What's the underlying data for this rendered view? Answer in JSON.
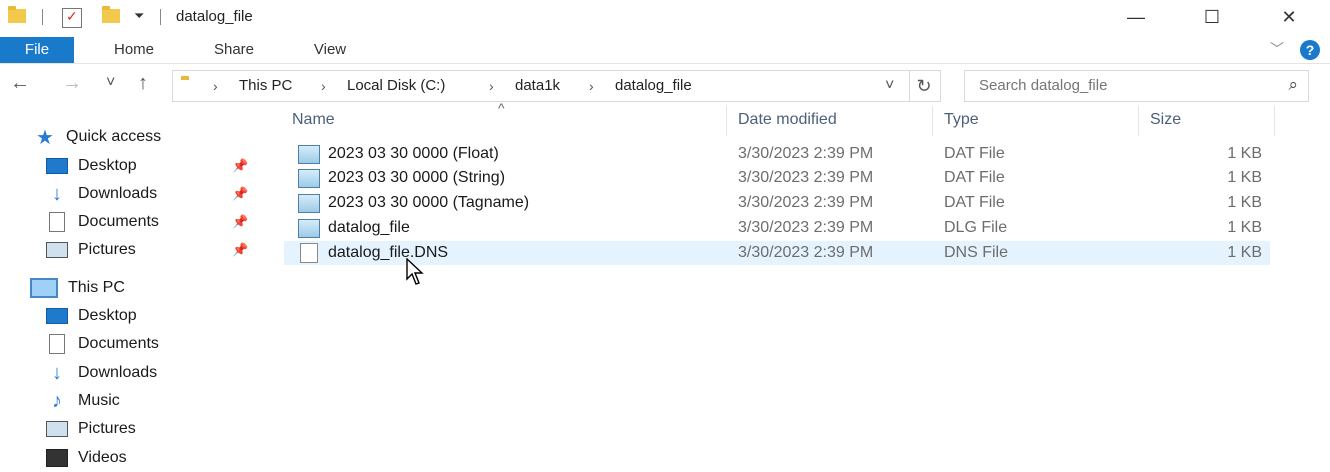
{
  "window": {
    "title": "datalog_file",
    "controls": {
      "minimize": "—",
      "maximize": "☐",
      "close": "✕"
    }
  },
  "ribbon": {
    "tabs": [
      "File",
      "Home",
      "Share",
      "View"
    ],
    "help": "?",
    "collapse_chevron": "﹀"
  },
  "navigation": {
    "back": "←",
    "forward": "→",
    "recent": "˅",
    "up": "↑",
    "breadcrumbs": [
      "This PC",
      "Local Disk (C:)",
      "data1k",
      "datalog_file"
    ],
    "crumb_sep": "›",
    "dropdown": "˅",
    "refresh": "↻",
    "search_placeholder": "Search datalog_file",
    "search_icon": "⌕"
  },
  "sidebar": {
    "quick_access": {
      "label": "Quick access",
      "icon": "star-icon",
      "items": [
        {
          "label": "Desktop",
          "icon": "desktop-icon",
          "pinned": true
        },
        {
          "label": "Downloads",
          "icon": "downloads-icon",
          "pinned": true
        },
        {
          "label": "Documents",
          "icon": "documents-icon",
          "pinned": true
        },
        {
          "label": "Pictures",
          "icon": "pictures-icon",
          "pinned": true
        }
      ]
    },
    "this_pc": {
      "label": "This PC",
      "icon": "computer-icon",
      "items": [
        {
          "label": "Desktop",
          "icon": "desktop-icon"
        },
        {
          "label": "Documents",
          "icon": "documents-icon"
        },
        {
          "label": "Downloads",
          "icon": "downloads-icon"
        },
        {
          "label": "Music",
          "icon": "music-icon"
        },
        {
          "label": "Pictures",
          "icon": "pictures-icon"
        },
        {
          "label": "Videos",
          "icon": "videos-icon"
        }
      ]
    },
    "pin_glyph": "📌"
  },
  "file_list": {
    "sort_caret": "^",
    "columns": [
      "Name",
      "Date modified",
      "Type",
      "Size"
    ],
    "rows": [
      {
        "name": "2023 03 30 0000 (Float)",
        "date": "3/30/2023 2:39 PM",
        "type": "DAT File",
        "size": "1 KB",
        "icon": "dat-file-icon"
      },
      {
        "name": "2023 03 30 0000 (String)",
        "date": "3/30/2023 2:39 PM",
        "type": "DAT File",
        "size": "1 KB",
        "icon": "dat-file-icon"
      },
      {
        "name": "2023 03 30 0000 (Tagname)",
        "date": "3/30/2023 2:39 PM",
        "type": "DAT File",
        "size": "1 KB",
        "icon": "dat-file-icon"
      },
      {
        "name": "datalog_file",
        "date": "3/30/2023 2:39 PM",
        "type": "DLG File",
        "size": "1 KB",
        "icon": "dlg-file-icon"
      },
      {
        "name": "datalog_file.DNS",
        "date": "3/30/2023 2:39 PM",
        "type": "DNS File",
        "size": "1 KB",
        "icon": "blank-file-icon",
        "hovered": true
      }
    ]
  },
  "colors": {
    "accent": "#1979ca",
    "hover_row": "#e5f3ff",
    "header_text": "#4c607a"
  }
}
